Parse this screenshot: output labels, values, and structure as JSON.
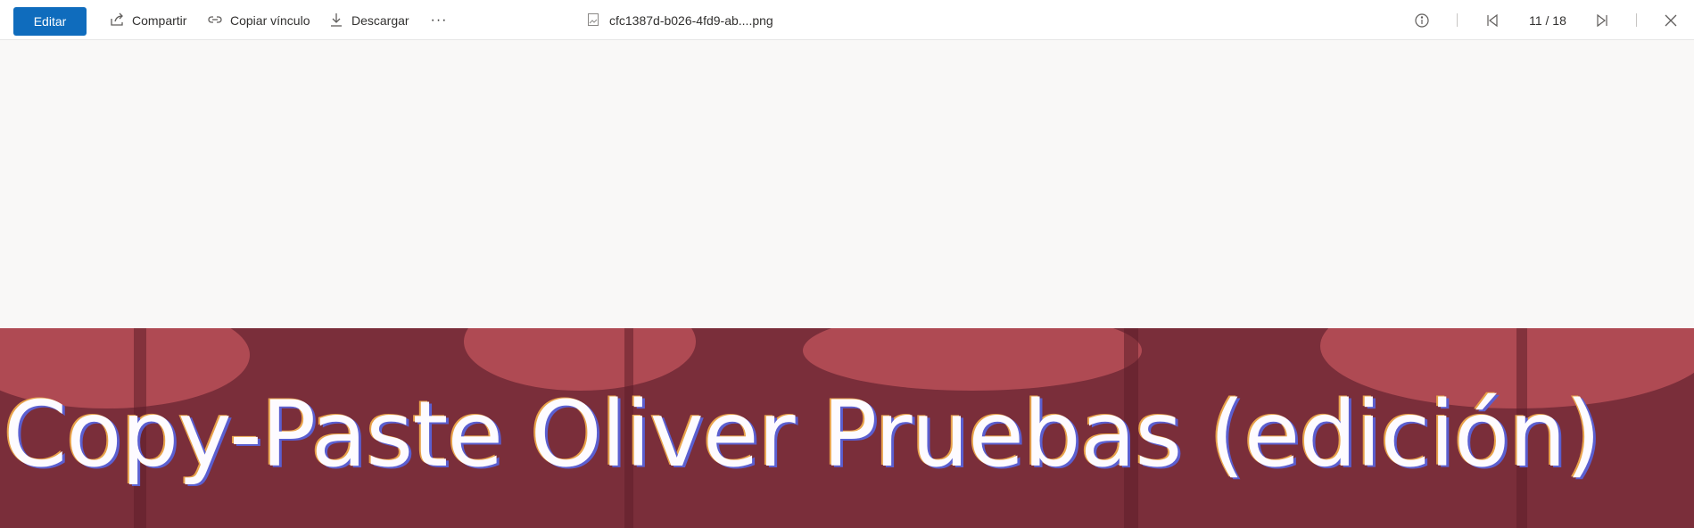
{
  "toolbar": {
    "edit_label": "Editar",
    "share_label": "Compartir",
    "copy_link_label": "Copiar vínculo",
    "download_label": "Descargar",
    "more_label": "···",
    "file_name": "cfc1387d-b026-4fd9-ab....png",
    "pager": "11 / 18"
  },
  "icons": {
    "share": "share-icon",
    "link": "link-icon",
    "download": "download-icon",
    "file": "image-file-icon",
    "info": "info-icon",
    "first": "first-page-icon",
    "last": "last-page-icon",
    "close": "close-icon"
  },
  "colors": {
    "accent": "#0f6cbd",
    "image_background": "#7a2e3a",
    "image_highlight": "#c2545c"
  },
  "image": {
    "caption": "Copy-Paste Oliver Pruebas (edición)"
  }
}
